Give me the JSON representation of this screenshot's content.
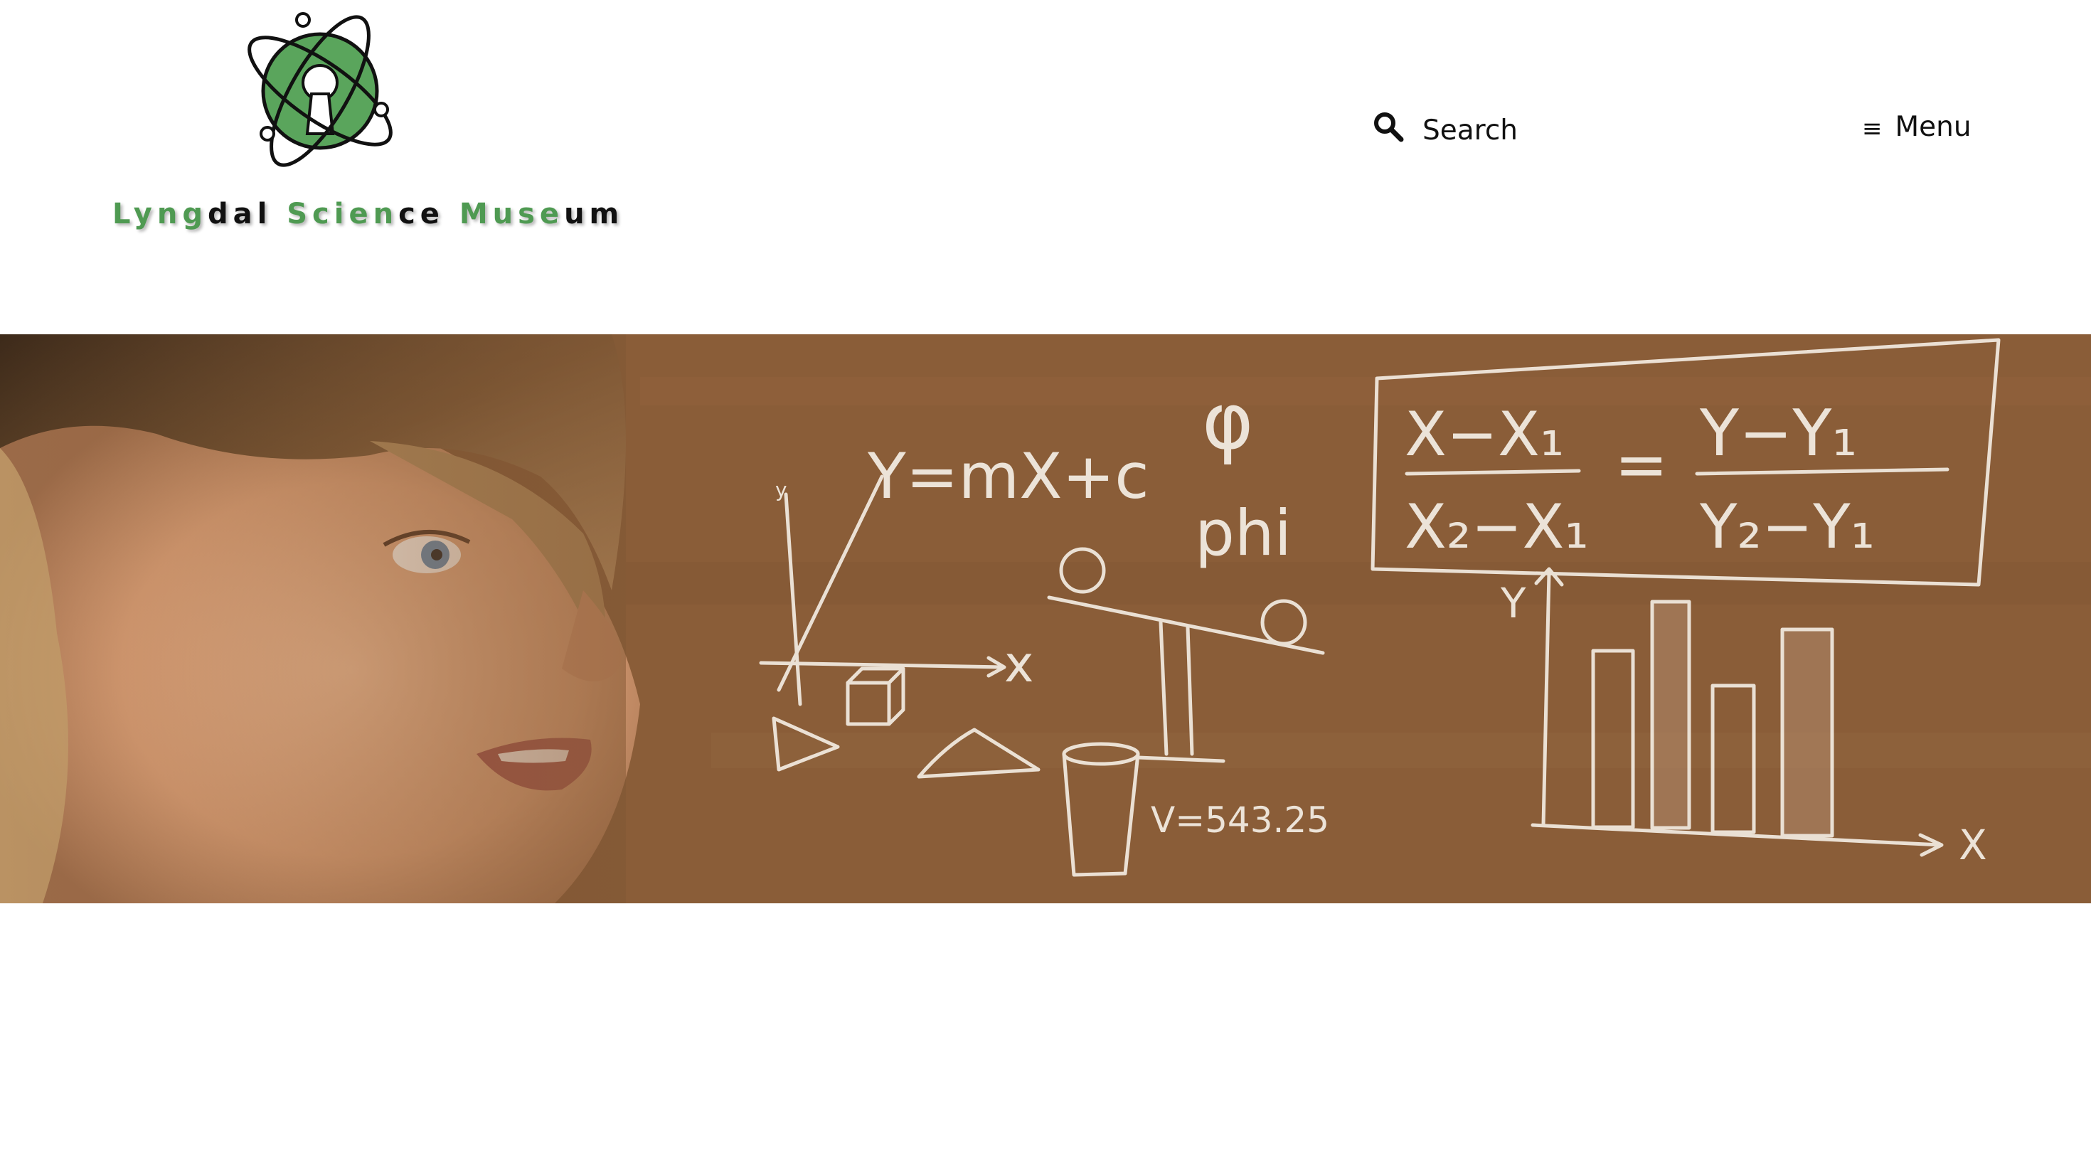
{
  "header": {
    "logo": {
      "wordmark_parts": [
        {
          "text": "Lyng",
          "tone": "green"
        },
        {
          "text": "dal ",
          "tone": "black"
        },
        {
          "text": "Scien",
          "tone": "green"
        },
        {
          "text": "ce ",
          "tone": "black"
        },
        {
          "text": "Muse",
          "tone": "green"
        },
        {
          "text": "um",
          "tone": "black"
        }
      ],
      "icon": "atom-keyhole-logo-icon"
    },
    "search": {
      "label": "Search",
      "icon": "search-icon"
    },
    "menu": {
      "label": "Menu",
      "icon": "hamburger-icon",
      "glyph": "≡"
    }
  },
  "hero": {
    "chalk_texts": {
      "line_equation": "Y=mX+c",
      "phi_symbol": "φ",
      "phi_word": "phi",
      "volume": "V=543.25",
      "slope_left_top": "X−X₁",
      "slope_left_bottom": "X₂−X₁",
      "slope_equals": "=",
      "slope_right_top": "Y−Y₁",
      "slope_right_bottom": "Y₂−Y₁",
      "axis_x": "x",
      "axis_y": "y",
      "axis_X": "X",
      "axis_Y": "Y"
    }
  },
  "colors": {
    "brand_green": "#4f9a52",
    "chalkboard": "#8b5e39",
    "chalk": "#f3ece2",
    "text_dark": "#111111"
  }
}
